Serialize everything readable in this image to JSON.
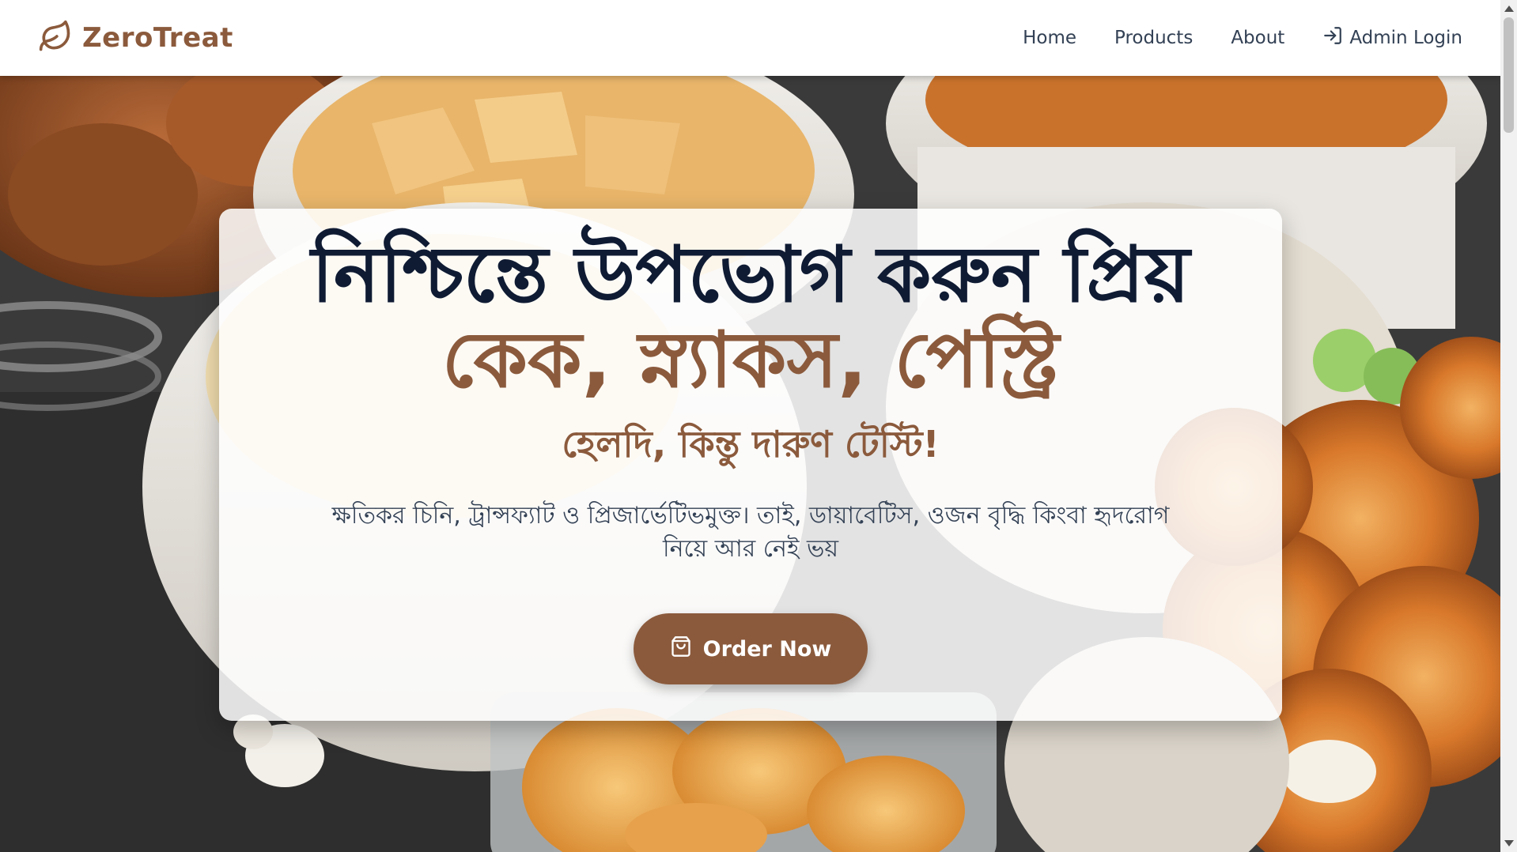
{
  "brand": {
    "name": "ZeroTreat",
    "color": "#8b5a3c"
  },
  "nav": {
    "items": [
      {
        "label": "Home"
      },
      {
        "label": "Products"
      },
      {
        "label": "About"
      },
      {
        "label": "Admin Login",
        "icon": "login-icon"
      }
    ]
  },
  "hero": {
    "headline_line1": "নিশ্চিন্তে উপভোগ করুন প্রিয়",
    "headline_line2": "কেক, স্ন্যাকস, পেস্ট্রি",
    "subheadline": "হেলদি, কিন্তু দারুণ টেস্টি!",
    "description": "ক্ষতিকর চিনি, ট্রান্সফ্যাট ও প্রিজার্ভেটিভমুক্ত। তাই, ডায়াবেটিস, ওজন বৃদ্ধি কিংবা হৃদরোগ নিয়ে আর নেই ভয়",
    "cta_label": "Order Now",
    "cta_icon": "shopping-bag-icon",
    "background": "food-snacks-photo"
  },
  "colors": {
    "accent": "#8b5a3c",
    "dark_text": "#0f1b33",
    "body_text": "#334155"
  }
}
